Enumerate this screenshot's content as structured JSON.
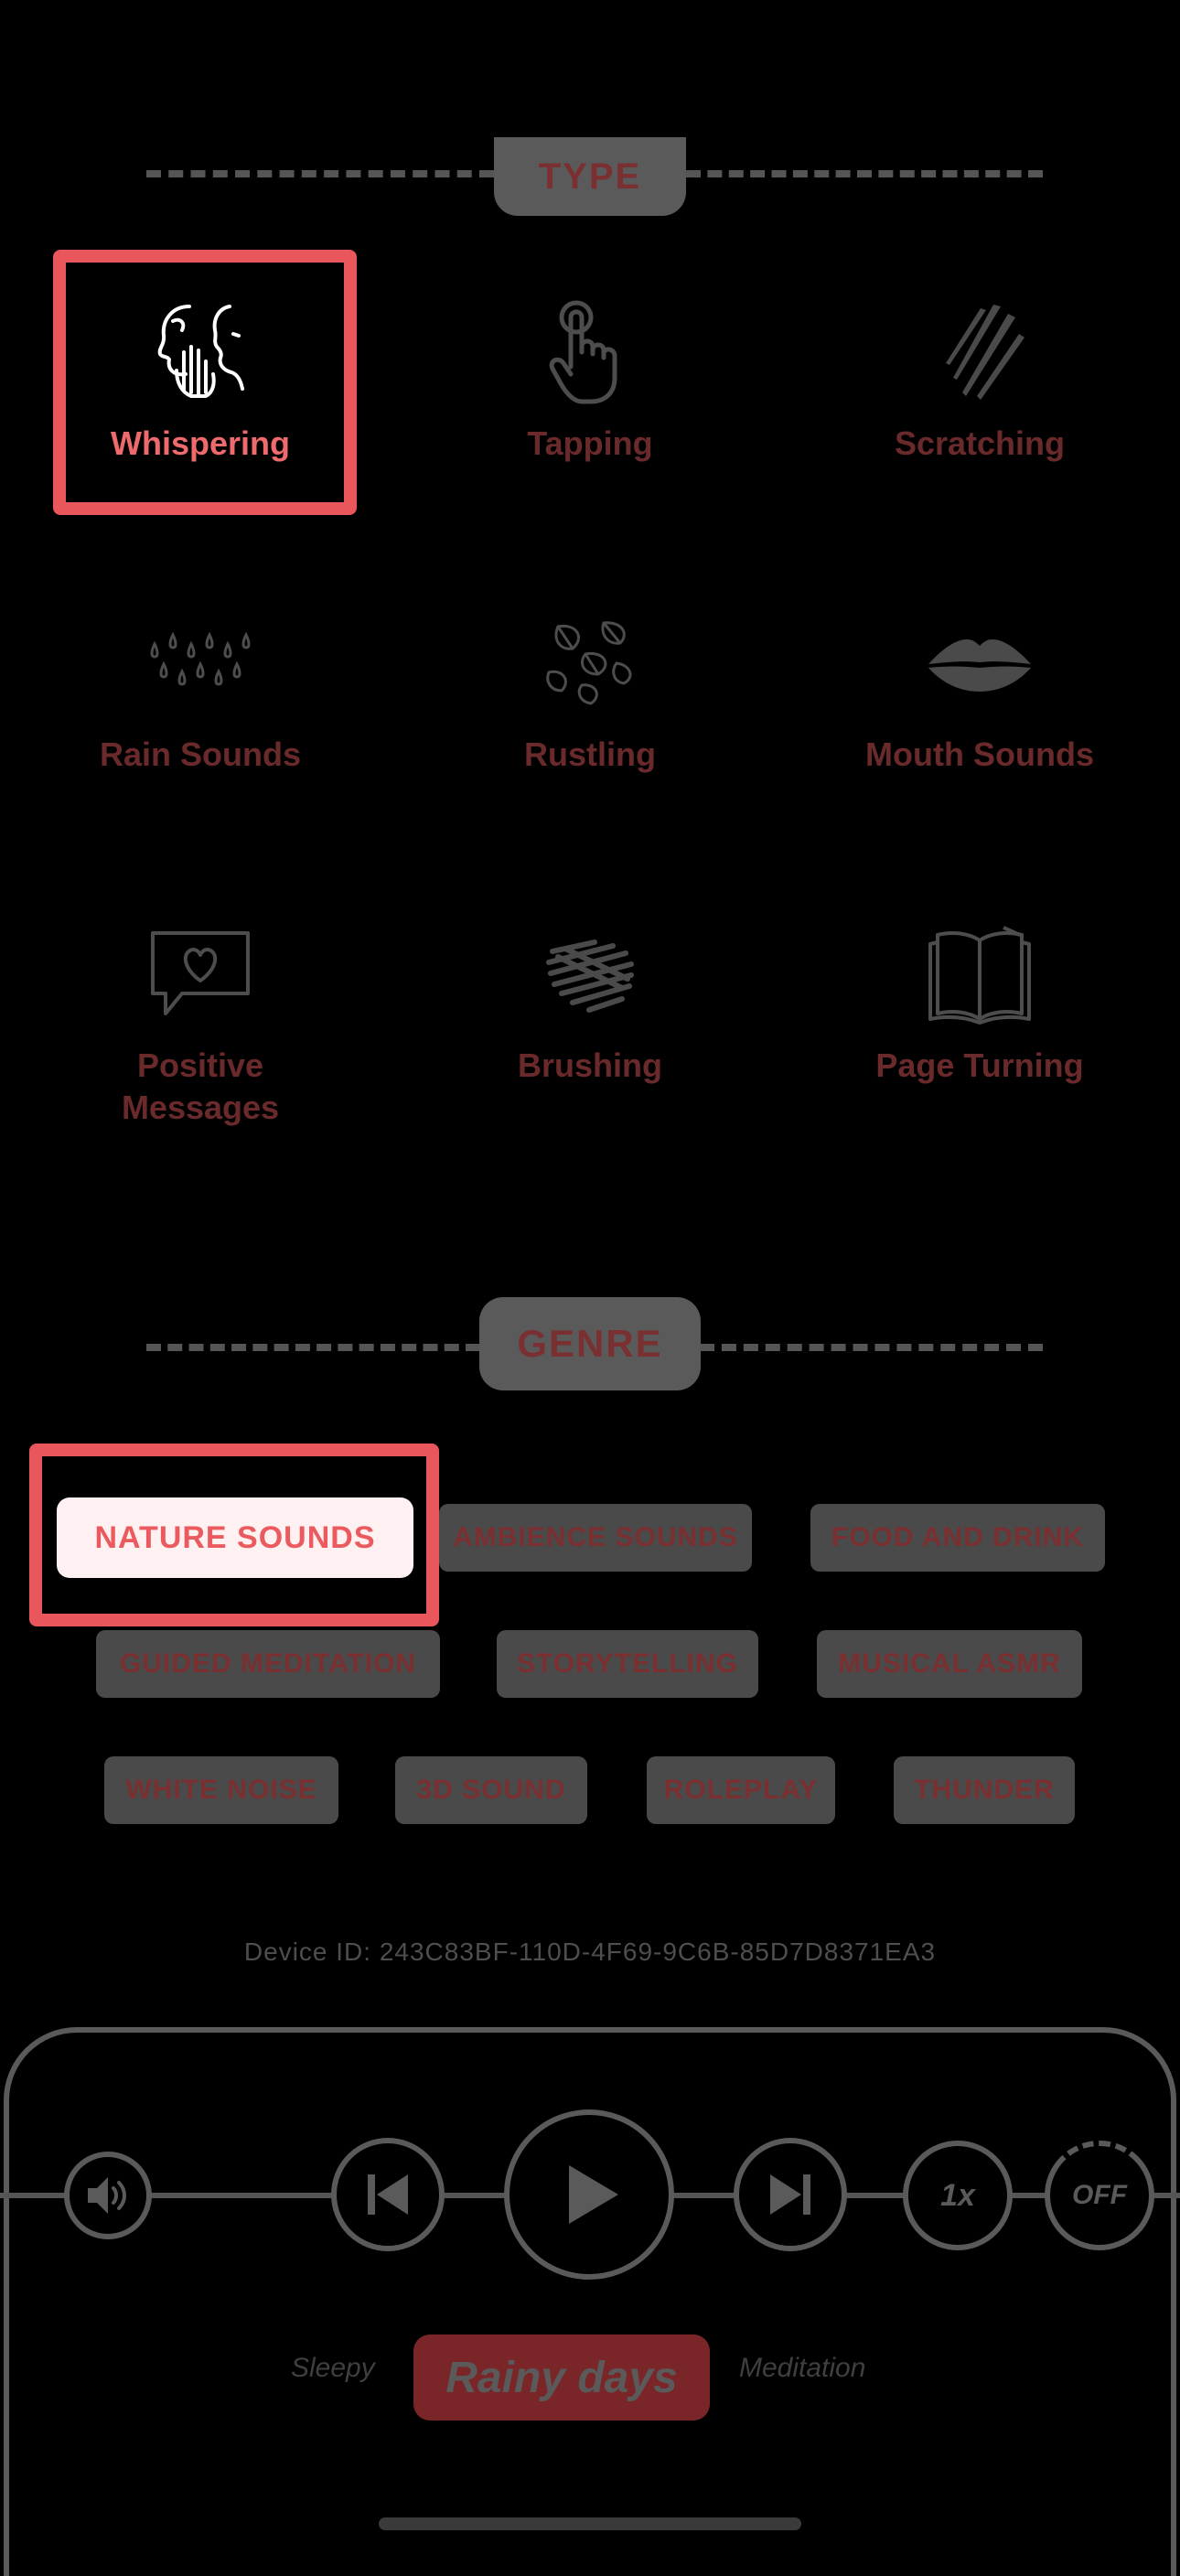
{
  "type_section": {
    "title": "TYPE",
    "items": [
      {
        "label": "Whispering",
        "icon": "whisper-icon",
        "selected": true
      },
      {
        "label": "Tapping",
        "icon": "tapping-finger-icon",
        "selected": false
      },
      {
        "label": "Scratching",
        "icon": "scratch-marks-icon",
        "selected": false
      },
      {
        "label": "Rain Sounds",
        "icon": "raindrops-icon",
        "selected": false
      },
      {
        "label": "Rustling",
        "icon": "leaves-icon",
        "selected": false
      },
      {
        "label": "Mouth Sounds",
        "icon": "lips-icon",
        "selected": false
      },
      {
        "label": "Positive\nMessages",
        "icon": "heart-message-icon",
        "selected": false
      },
      {
        "label": "Brushing",
        "icon": "brush-scribble-icon",
        "selected": false
      },
      {
        "label": "Page Turning",
        "icon": "open-book-icon",
        "selected": false
      }
    ]
  },
  "genre_section": {
    "title": "GENRE",
    "chips": [
      {
        "label": "NATURE SOUNDS",
        "selected": true
      },
      {
        "label": "AMBIENCE SOUNDS",
        "selected": false
      },
      {
        "label": "FOOD AND DRINK",
        "selected": false
      },
      {
        "label": "GUIDED MEDITATION",
        "selected": false
      },
      {
        "label": "STORYTELLING",
        "selected": false
      },
      {
        "label": "MUSICAL ASMR",
        "selected": false
      },
      {
        "label": "WHITE NOISE",
        "selected": false
      },
      {
        "label": "3D SOUND",
        "selected": false
      },
      {
        "label": "ROLEPLAY",
        "selected": false
      },
      {
        "label": "THUNDER",
        "selected": false
      }
    ]
  },
  "device_id": "Device ID: 243C83BF-110D-4F69-9C6B-85D7D8371EA3",
  "player": {
    "speed_label": "1x",
    "timer_label": "OFF",
    "modes": {
      "left": "Sleepy",
      "active": "Rainy days",
      "right": "Meditation"
    }
  },
  "colors": {
    "accent": "#E9565C",
    "selected_text": "#EF6A6D",
    "dim_text": "#6A2A2C"
  }
}
